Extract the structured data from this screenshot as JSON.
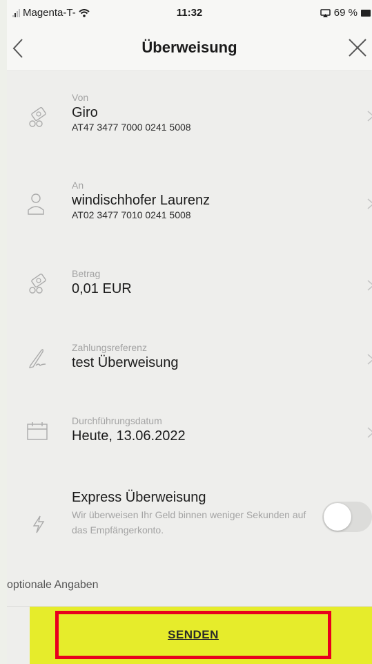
{
  "statusbar": {
    "carrier": "Magenta-T-",
    "time": "11:32",
    "battery": "69 %"
  },
  "header": {
    "title": "Überweisung"
  },
  "fields": {
    "von": {
      "label": "Von",
      "value": "Giro",
      "sub": "AT47 3477 7000 0241 5008"
    },
    "an": {
      "label": "An",
      "value": "windischhofer Laurenz",
      "sub": "AT02 3477 7010 0241 5008"
    },
    "betrag": {
      "label": "Betrag",
      "value": "0,01 EUR"
    },
    "referenz": {
      "label": "Zahlungsreferenz",
      "value": "test Überweisung"
    },
    "datum": {
      "label": "Durchführungsdatum",
      "value": "Heute, 13.06.2022"
    }
  },
  "express": {
    "title": "Express Überweisung",
    "description": "Wir überweisen Ihr Geld binnen weniger Sekunden auf das Empfängerkonto.",
    "enabled": false
  },
  "optional_label": "optionale Angaben",
  "send_label": "SENDEN",
  "colors": {
    "send_bar": "#e6ec2b",
    "highlight_border": "#e8001d",
    "background": "#eeeeec"
  },
  "icons": {
    "back": "chevron-left-icon",
    "close": "close-icon",
    "account": "money-icon",
    "recipient": "person-icon",
    "reference": "signature-icon",
    "date": "calendar-icon",
    "express": "lightning-icon"
  }
}
